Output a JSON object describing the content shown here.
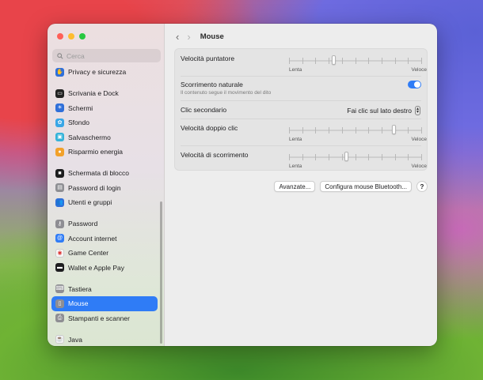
{
  "window": {
    "title": "Mouse"
  },
  "search": {
    "placeholder": "Cerca"
  },
  "sidebar": {
    "items": [
      {
        "label": "Privacy e sicurezza",
        "icon": "privacy-hand-icon",
        "color": "#2f6fd9",
        "glyph": "✋"
      },
      {
        "label": "Scrivania e Dock",
        "icon": "desktop-dock-icon",
        "color": "#222222",
        "glyph": "▭"
      },
      {
        "label": "Schermi",
        "icon": "display-icon",
        "color": "#2f6fd9",
        "glyph": "☀"
      },
      {
        "label": "Sfondo",
        "icon": "wallpaper-icon",
        "color": "#39a6e6",
        "glyph": "✿"
      },
      {
        "label": "Salvaschermo",
        "icon": "screensaver-icon",
        "color": "#34b3d9",
        "glyph": "▣"
      },
      {
        "label": "Risparmio energia",
        "icon": "battery-icon",
        "color": "#f2a12b",
        "glyph": "●"
      },
      {
        "label": "Schermata di blocco",
        "icon": "lock-screen-icon",
        "color": "#1d1d1f",
        "glyph": "■"
      },
      {
        "label": "Password di login",
        "icon": "login-password-icon",
        "color": "#8e8e93",
        "glyph": "▤"
      },
      {
        "label": "Utenti e gruppi",
        "icon": "users-groups-icon",
        "color": "#2f6fd9",
        "glyph": "👥"
      },
      {
        "label": "Password",
        "icon": "key-icon",
        "color": "#8e8e93",
        "glyph": "⚷"
      },
      {
        "label": "Account internet",
        "icon": "at-icon",
        "color": "#2f7cf6",
        "glyph": "@"
      },
      {
        "label": "Game Center",
        "icon": "game-center-icon",
        "color": "#f7f7f7",
        "glyph": "◉"
      },
      {
        "label": "Wallet e Apple Pay",
        "icon": "wallet-icon",
        "color": "#1d1d1f",
        "glyph": "▬"
      },
      {
        "label": "Tastiera",
        "icon": "keyboard-icon",
        "color": "#8e8e93",
        "glyph": "⌨"
      },
      {
        "label": "Mouse",
        "icon": "mouse-icon",
        "color": "#8e8e93",
        "glyph": "▯"
      },
      {
        "label": "Stampanti e scanner",
        "icon": "printer-icon",
        "color": "#8e8e93",
        "glyph": "⎙"
      },
      {
        "label": "Java",
        "icon": "java-icon",
        "color": "#f2f2f2",
        "glyph": "☕"
      }
    ],
    "active": "Mouse"
  },
  "settings": {
    "tracking_speed": {
      "label": "Velocità puntatore",
      "min_label": "Lenta",
      "max_label": "Veloce",
      "level": 0.33
    },
    "natural_scrolling": {
      "label": "Scorrimento naturale",
      "description": "Il contenuto segue il movimento del dito",
      "enabled": true
    },
    "secondary_click": {
      "label": "Clic secondario",
      "value": "Fai clic sul lato destro"
    },
    "double_click_speed": {
      "label": "Velocità doppio clic",
      "min_label": "Lenta",
      "max_label": "Veloce",
      "level": 0.8
    },
    "scrolling_speed": {
      "label": "Velocità di scorrimento",
      "min_label": "Lenta",
      "max_label": "Veloce",
      "level": 0.43
    }
  },
  "buttons": {
    "advanced": "Avanzate...",
    "bluetooth": "Configura mouse Bluetooth...",
    "help": "?"
  },
  "nav": {
    "back": "‹",
    "forward": "›"
  }
}
